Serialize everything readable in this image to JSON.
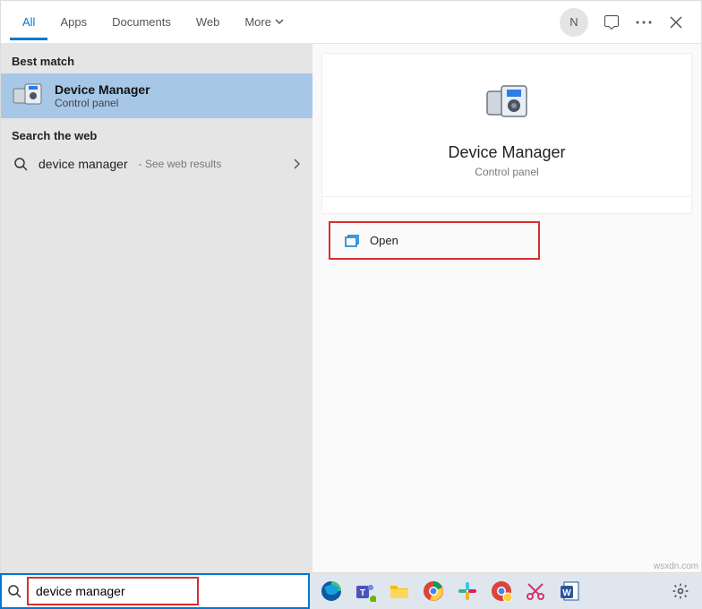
{
  "tabs": {
    "all": "All",
    "apps": "Apps",
    "documents": "Documents",
    "web": "Web",
    "more": "More"
  },
  "user_initial": "N",
  "sections": {
    "best_match": "Best match",
    "search_web": "Search the web"
  },
  "best_match": {
    "title": "Device Manager",
    "subtitle": "Control panel"
  },
  "web_result": {
    "query": "device manager",
    "hint": "- See web results"
  },
  "preview": {
    "title": "Device Manager",
    "subtitle": "Control panel"
  },
  "actions": {
    "open": "Open"
  },
  "searchbox": {
    "value": "device manager"
  },
  "watermark": "wsxdn.com"
}
